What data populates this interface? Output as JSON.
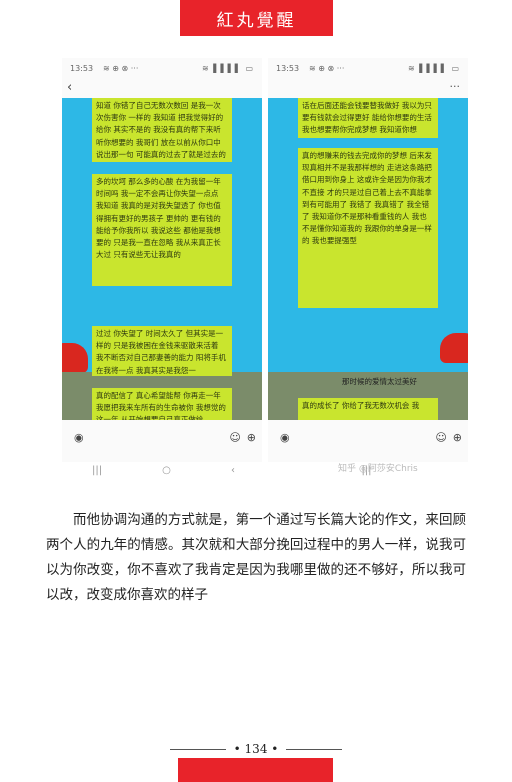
{
  "header": {
    "title": "紅丸覺醒"
  },
  "screens": [
    {
      "status": {
        "time": "13:53",
        "icons": "≋ ⊕ ⊗ ···",
        "signal": "≋ ▌▌▌▌ ▭"
      },
      "messages": [
        "知道 你错了自己无数次数回 是我一次次伤害你 一样的 我知道 把我觉得好的给你 其实不是的 我没有真的帮下来听听你想要的 我哥们 放在以前从你口中说出那一句 可能真的过去了就是过去的",
        "多的坎坷 那么多的心酸 在为我留一年时间吗 我一定不会再让你失望一点点 我知道 我真的是对我失望透了 你也值得拥有更好的男孩子 更帅的 更有钱的 能给予你我所以 我说这些 都他是我想要的 只是我一直在忽略 我从来真正长大过 只有说些无让我真的",
        "过过 你失望了 时间太久了 但其实是一样的 只是我被困在金钱来驱散来活着 我不断否对自己那妻善的能力 阳将手机 在我将一点 我真其实是我怨一",
        "真的配信了 真心希望能帮 你再走一年 我愿把我来车所有的生命被你 我想觉的这一年 从开始想要自己真正做给"
      ]
    },
    {
      "status": {
        "time": "13:53",
        "icons": "≋ ⊕ ⊗ ···",
        "signal": "≋ ▌▌▌▌ ▭"
      },
      "messages": [
        "话在后面还能会钱要替我做好 我以为只要有钱就会过得更好 能给你想要的生活 我也想要帮你完成梦想 我知道你想",
        "真的想赚来的钱去完成你的梦想 后来发现真相并不是我那样想的 走进这条路把借口用到你身上 这或许全是因为你我才不直接 才的只是过自己着上去不真能拿到有可能用了 我错了 我真错了 我全错了 我知道你不是那种看重钱的人 我也不是懂你知道我的 我跟你的单身是一样的 我也要提强型",
        "那时候的爱情太过美好",
        "真的成长了 你给了我无数次机会 我"
      ]
    }
  ],
  "watermark": "知乎 @阿莎安Chris",
  "body_text": "而他协调沟通的方式就是，第一个通过写长篇大论的作文，来回顾两个人的九年的情感。其次就和大部分挽回过程中的男人一样，说我可以为你改变，你不喜欢了我肯定是因为我哪里做的还不够好，所以我可以改，改变成你喜欢的样子",
  "page_number": "134",
  "colors": {
    "brand_red": "#e8232a",
    "chat_background": "#2db8e6",
    "bubble_green": "#c9e52e"
  },
  "icons": [
    "back-arrow-icon",
    "more-dots-icon",
    "voice-icon",
    "emoji-icon",
    "plus-icon",
    "recent-apps-icon",
    "home-icon",
    "back-nav-icon"
  ]
}
